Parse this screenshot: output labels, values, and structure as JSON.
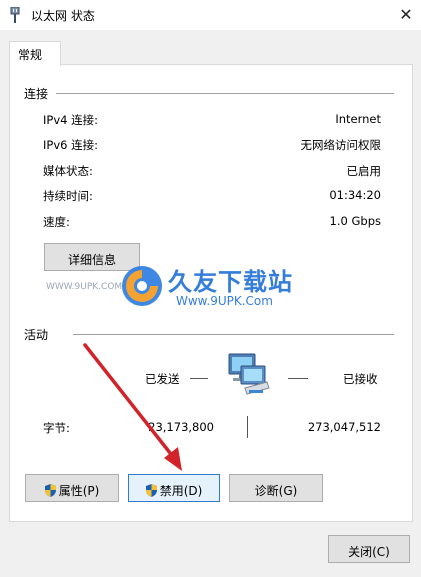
{
  "window": {
    "title": "以太网 状态",
    "close_glyph": "✕"
  },
  "tab": {
    "label": "常规"
  },
  "connection": {
    "section_title": "连接",
    "rows": [
      {
        "label": "IPv4 连接:",
        "value": "Internet"
      },
      {
        "label": "IPv6 连接:",
        "value": "无网络访问权限"
      },
      {
        "label": "媒体状态:",
        "value": "已启用"
      },
      {
        "label": "持续时间:",
        "value": "01:34:20"
      },
      {
        "label": "速度:",
        "value": "1.0 Gbps"
      }
    ],
    "details_button": "详细信息"
  },
  "activity": {
    "section_title": "活动",
    "sent_label": "已发送",
    "received_label": "已接收",
    "bytes_label": "字节:",
    "bytes_sent": "23,173,800",
    "bytes_received": "273,047,512"
  },
  "buttons": {
    "properties": "属性(P)",
    "disable": "禁用(D)",
    "diagnose": "诊断(G)",
    "close": "关闭(C)"
  },
  "watermark": {
    "brand": "久友下载站",
    "url": "Www.9UPK.Com",
    "url_small": "WWW.9UPK.COM"
  },
  "colors": {
    "accent_blue": "#2e7bd4",
    "arrow_red": "#d2232a",
    "shield_blue": "#1a5fb4",
    "shield_yellow": "#f2c230"
  }
}
